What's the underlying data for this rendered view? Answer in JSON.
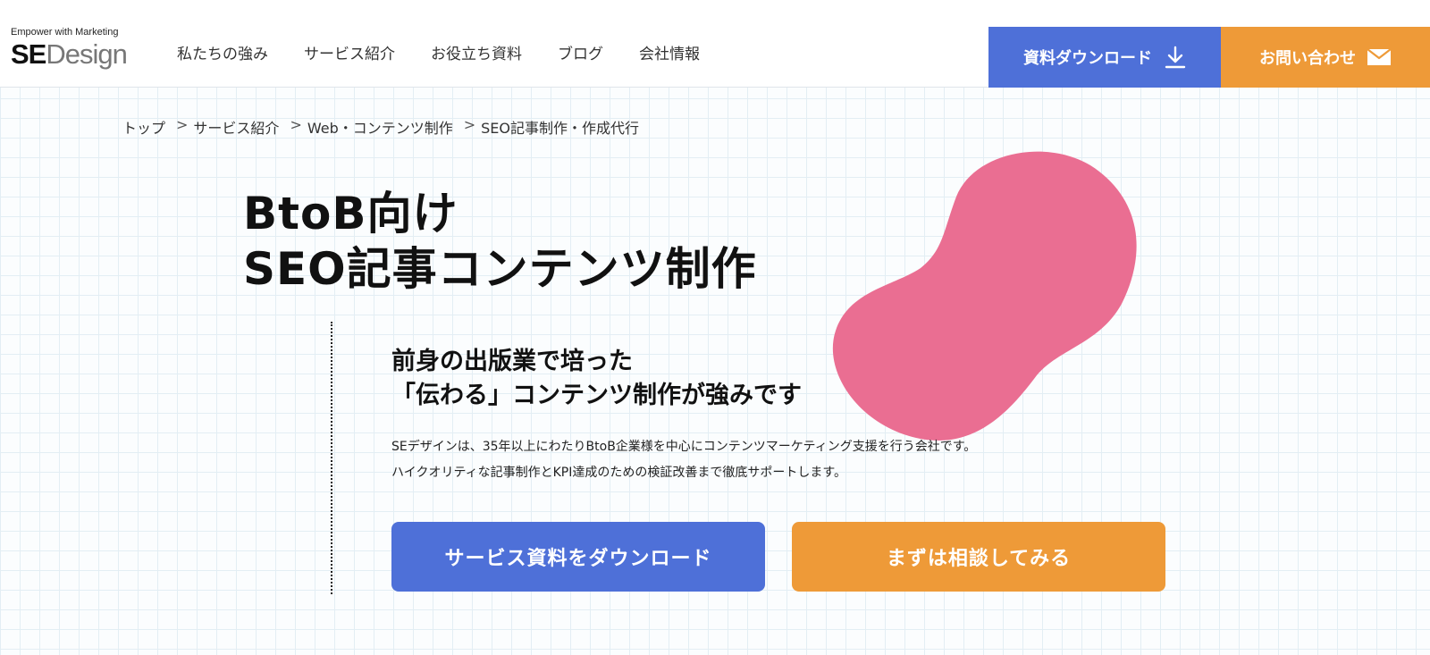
{
  "header": {
    "logo": {
      "tagline": "Empower with Marketing",
      "mark_bold": "SE",
      "mark_light": "Design"
    },
    "nav": [
      {
        "label": "私たちの強み"
      },
      {
        "label": "サービス紹介"
      },
      {
        "label": "お役立ち資料"
      },
      {
        "label": "ブログ"
      },
      {
        "label": "会社情報"
      }
    ],
    "download_button": {
      "label": "資料ダウンロード",
      "icon": "download-icon",
      "color": "#4e70d8"
    },
    "contact_button": {
      "label": "お問い合わせ",
      "icon": "mail-icon",
      "color": "#ee9a38"
    }
  },
  "breadcrumb": {
    "items": [
      "トップ",
      "サービス紹介",
      "Web・コンテンツ制作",
      "SEO記事制作・作成代行"
    ],
    "separator": ">"
  },
  "hero": {
    "title_line1": "BtoB向け",
    "title_line2": "SEO記事コンテンツ制作",
    "subheading_line1": "前身の出版業で培った",
    "subheading_line2": "「伝わる」コンテンツ制作が強みです",
    "body_line1": "SEデザインは、35年以上にわたりBtoB企業様を中心にコンテンツマーケティング支援を行う会社です。",
    "body_line2": "ハイクオリティな記事制作とKPI達成のための検証改善まで徹底サポートします。",
    "blob_color": "#ea6e92",
    "buttons": {
      "primary": {
        "label": "サービス資料をダウンロード",
        "color": "#4e70d8"
      },
      "secondary": {
        "label": "まずは相談してみる",
        "color": "#ee9a38"
      }
    }
  }
}
